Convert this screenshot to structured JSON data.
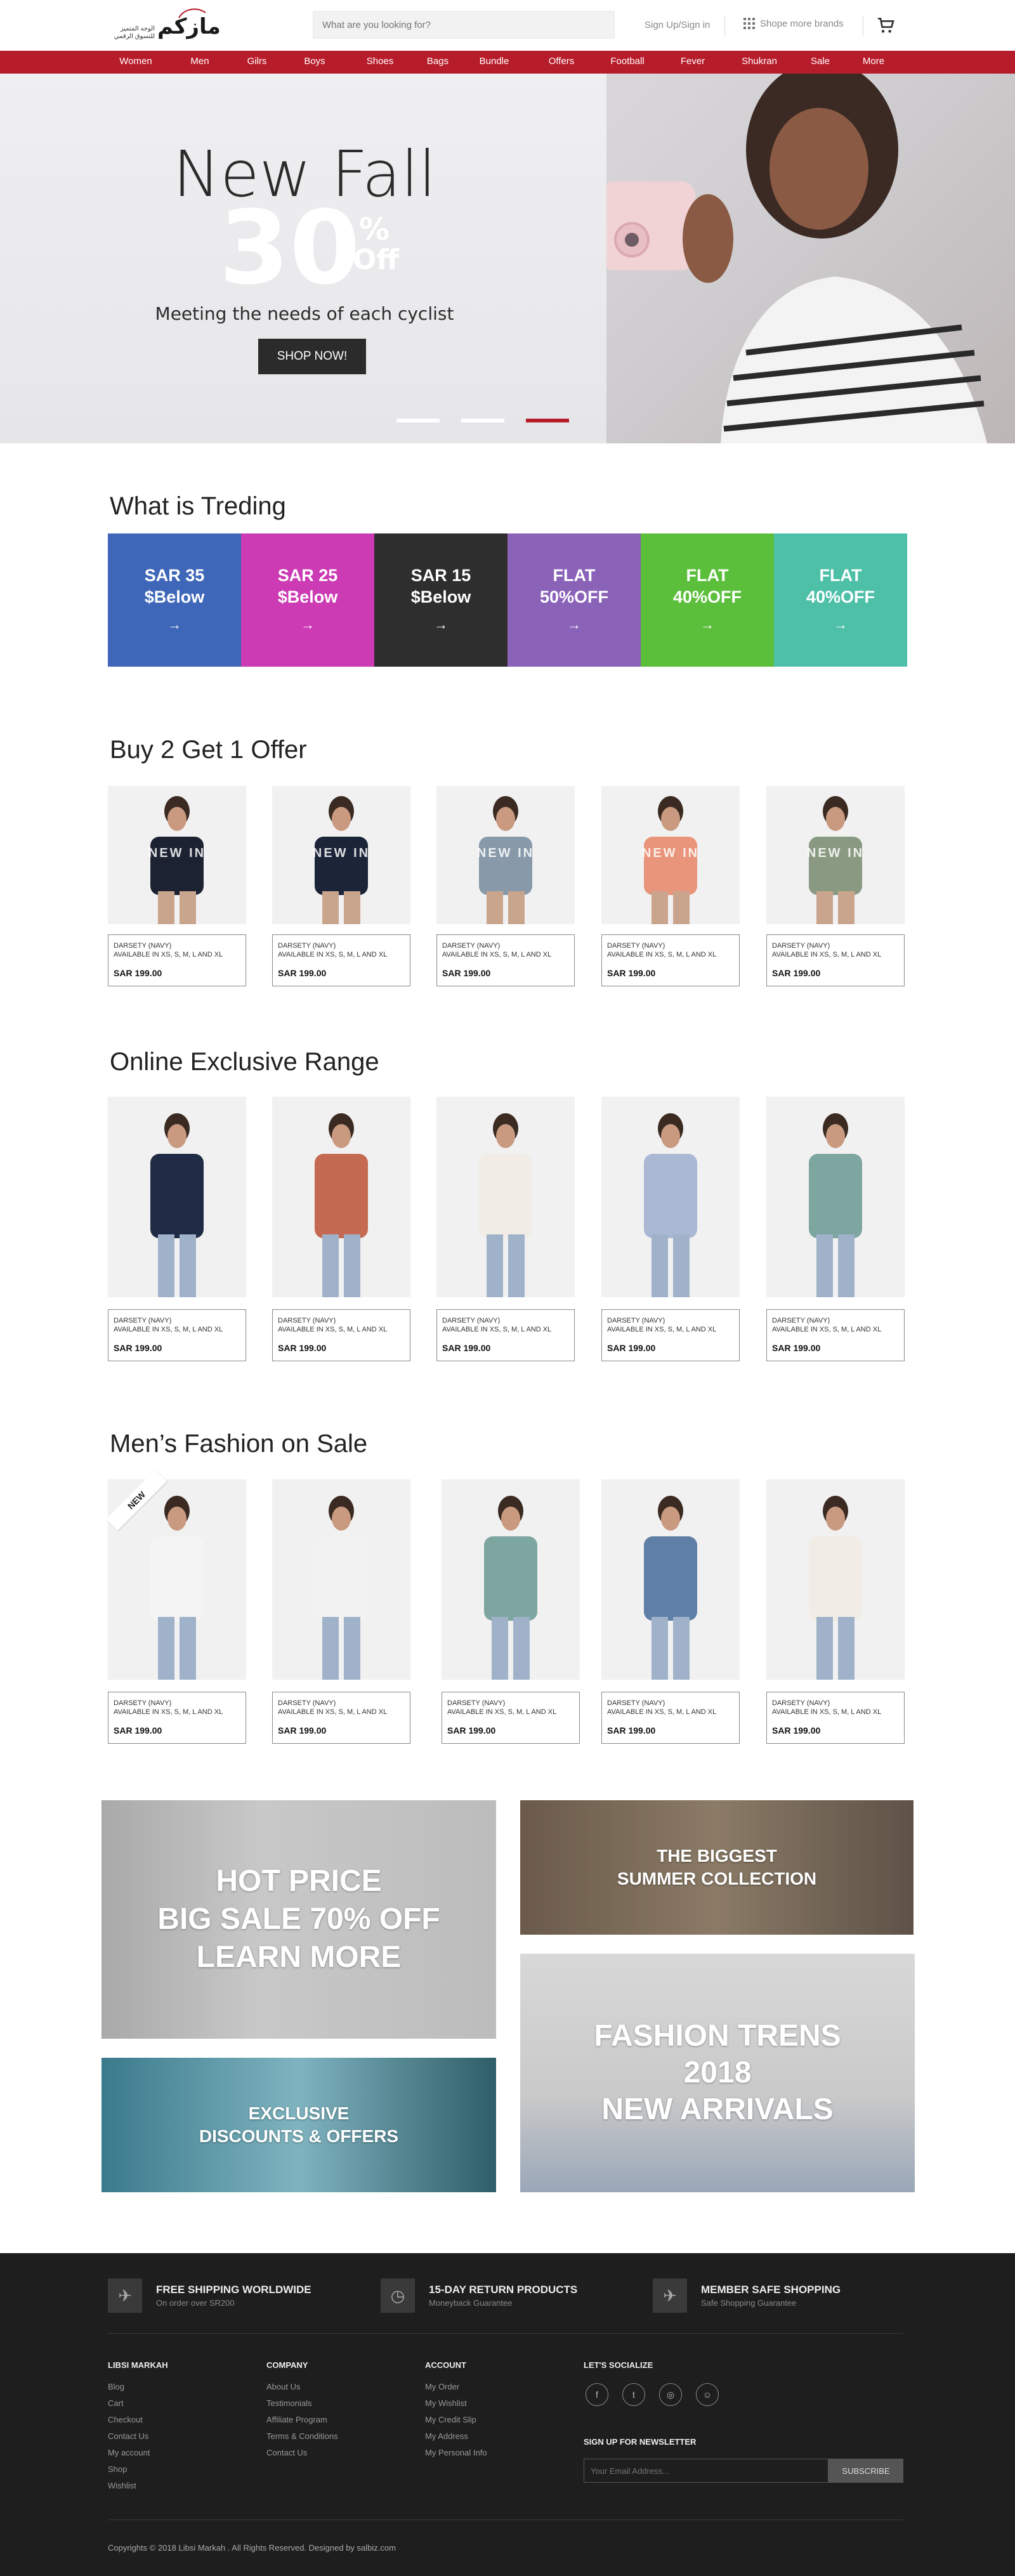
{
  "header": {
    "logo_arabic": "مازكم",
    "logo_sub": "الوجه المتميز للتسوق الرقمي",
    "search_placeholder": "What are you looking for?",
    "signin": "Sign Up/Sign in",
    "brands": "Shope more brands",
    "cart_icon": "cart-icon"
  },
  "nav": [
    "Women",
    "Men",
    "Gilrs",
    "Boys",
    "Shoes",
    "Bags",
    "Bundle",
    "Offers",
    "Football",
    "Fever",
    "Shukran",
    "Sale",
    "More"
  ],
  "hero": {
    "title": "New Fall",
    "percent": "30",
    "pct_sign": "%",
    "off": "Off",
    "subtitle": "Meeting the needs of each cyclist",
    "cta": "SHOP NOW!",
    "slides": 3,
    "active_slide": 3
  },
  "trending": {
    "title": "What is Treding",
    "tiles": [
      {
        "l1": "SAR 35",
        "l2": "$Below",
        "color": "#3f67b9"
      },
      {
        "l1": "SAR 25",
        "l2": "$Below",
        "color": "#cc3ab4"
      },
      {
        "l1": "SAR 15",
        "l2": "$Below",
        "color": "#2e2e2e"
      },
      {
        "l1": "FLAT",
        "l2": "50%OFF",
        "color": "#8a62b8"
      },
      {
        "l1": "FLAT",
        "l2": "40%OFF",
        "color": "#5cbf3c"
      },
      {
        "l1": "FLAT",
        "l2": "40%OFF",
        "color": "#4ec0a8"
      }
    ]
  },
  "buy2": {
    "title": "Buy 2 Get 1 Offer",
    "products": [
      {
        "name": "DARSETY (NAVY)",
        "sizes": "AVAILABLE IN XS, S, M, L AND XL",
        "price": "SAR 199.00",
        "overlay": "NEW IN"
      },
      {
        "name": "DARSETY (NAVY)",
        "sizes": "AVAILABLE IN XS, S, M, L AND XL",
        "price": "SAR 199.00",
        "overlay": "NEW IN"
      },
      {
        "name": "DARSETY (NAVY)",
        "sizes": "AVAILABLE IN XS, S, M, L AND XL",
        "price": "SAR 199.00",
        "overlay": "NEW IN"
      },
      {
        "name": "DARSETY (NAVY)",
        "sizes": "AVAILABLE IN XS, S, M, L AND XL",
        "price": "SAR 199.00",
        "overlay": "NEW IN"
      },
      {
        "name": "DARSETY (NAVY)",
        "sizes": "AVAILABLE IN XS, S, M, L AND XL",
        "price": "SAR 199.00",
        "overlay": "NEW IN"
      }
    ]
  },
  "exclusive": {
    "title": "Online Exclusive Range",
    "products": [
      {
        "name": "DARSETY (NAVY)",
        "sizes": "AVAILABLE IN XS, S, M, L AND XL",
        "price": "SAR 199.00"
      },
      {
        "name": "DARSETY (NAVY)",
        "sizes": "AVAILABLE IN XS, S, M, L AND XL",
        "price": "SAR 199.00"
      },
      {
        "name": "DARSETY (NAVY)",
        "sizes": "AVAILABLE IN XS, S, M, L AND XL",
        "price": "SAR 199.00"
      },
      {
        "name": "DARSETY (NAVY)",
        "sizes": "AVAILABLE IN XS, S, M, L AND XL",
        "price": "SAR 199.00"
      },
      {
        "name": "DARSETY (NAVY)",
        "sizes": "AVAILABLE IN XS, S, M, L AND XL",
        "price": "SAR 199.00"
      }
    ]
  },
  "mens": {
    "title": "Men’s Fashion on Sale",
    "new_badge": "NEW",
    "products": [
      {
        "name": "DARSETY (NAVY)",
        "sizes": "AVAILABLE IN XS, S, M, L AND XL",
        "price": "SAR 199.00"
      },
      {
        "name": "DARSETY (NAVY)",
        "sizes": "AVAILABLE IN XS, S, M, L AND XL",
        "price": "SAR 199.00"
      },
      {
        "name": "DARSETY (NAVY)",
        "sizes": "AVAILABLE IN XS, S, M, L AND XL",
        "price": "SAR 199.00"
      },
      {
        "name": "DARSETY (NAVY)",
        "sizes": "AVAILABLE IN XS, S, M, L AND XL",
        "price": "SAR 199.00"
      },
      {
        "name": "DARSETY (NAVY)",
        "sizes": "AVAILABLE IN XS, S, M, L AND XL",
        "price": "SAR 199.00"
      }
    ]
  },
  "banners": {
    "hot": [
      "HOT PRICE",
      "BIG SALE 70% OFF",
      "LEARN MORE"
    ],
    "summer": [
      "THE BIGGEST",
      "SUMMER COLLECTION"
    ],
    "exclusive": [
      "EXCLUSIVE",
      "DISCOUNTS & OFFERS"
    ],
    "fashion": [
      "FASHION TRENS",
      "2018",
      "NEW ARRIVALS"
    ]
  },
  "footer": {
    "features": [
      {
        "title": "FREE SHIPPING WORLDWIDE",
        "sub": "On order over SR200",
        "icon": "plane-icon"
      },
      {
        "title": "15-DAY RETURN PRODUCTS",
        "sub": "Moneyback Guarantee",
        "icon": "clock-icon"
      },
      {
        "title": "MEMBER SAFE SHOPPING",
        "sub": "Safe Shopping Guarantee",
        "icon": "plane-icon"
      }
    ],
    "cols": [
      {
        "title": "LIBSI MARKAH",
        "links": [
          "Blog",
          "Cart",
          "Checkout",
          "Contact Us",
          "My account",
          "Shop",
          "Wishlist"
        ]
      },
      {
        "title": "COMPANY",
        "links": [
          "About Us",
          "Testimonials",
          "Affiliate Program",
          "Terms & Conditions",
          "Contact Us"
        ]
      },
      {
        "title": "ACCOUNT",
        "links": [
          "My Order",
          "My Wishlist",
          "My Credit Slip",
          "My Address",
          "My Personal Info"
        ]
      }
    ],
    "social_title": "LET'S SOCIALIZE",
    "social": [
      "f",
      "t",
      "◎",
      "☺"
    ],
    "newsletter_title": "SIGN UP FOR NEWSLETTER",
    "email_placeholder": "Your Email Address...",
    "subscribe": "SUBSCRIBE",
    "copyright": "Copyrights © 2018 Libsi Markah . All Rights Reserved. Designed by salbiz.com"
  },
  "colors": {
    "accent": "#b71c2a",
    "footer": "#1e1e1e",
    "dark_button": "#2b2b2b"
  }
}
